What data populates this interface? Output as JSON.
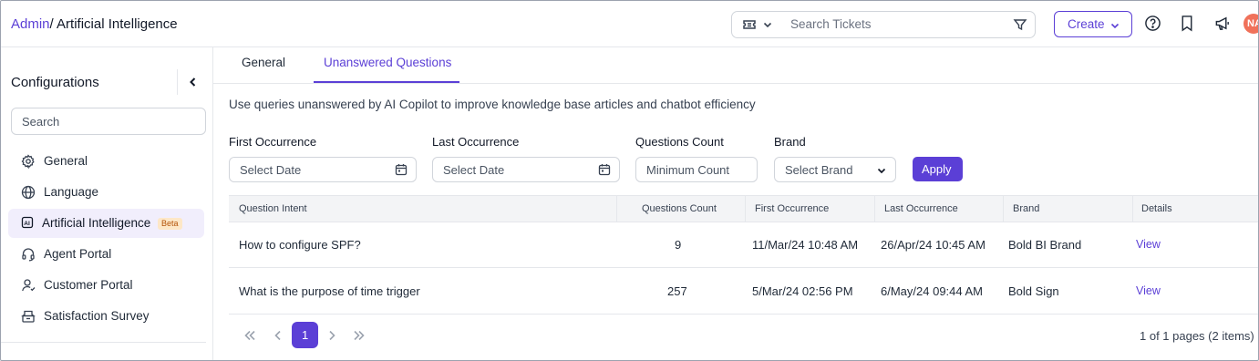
{
  "breadcrumb": {
    "parent": "Admin",
    "separator": "/",
    "current": "Artificial Intelligence"
  },
  "header": {
    "search_placeholder": "Search Tickets",
    "create_label": "Create",
    "avatar_initials": "NA",
    "icons": [
      "ticket-icon",
      "chevron-down-icon",
      "filter-icon",
      "help-icon",
      "bookmark-icon",
      "megaphone-icon"
    ]
  },
  "sidebar": {
    "title": "Configurations",
    "search_placeholder": "Search",
    "items": [
      {
        "label": "General",
        "icon": "gear-icon",
        "active": false
      },
      {
        "label": "Language",
        "icon": "globe-icon",
        "active": false
      },
      {
        "label": "Artificial Intelligence",
        "icon": "ai-icon",
        "active": true,
        "badge": "Beta"
      },
      {
        "label": "Agent Portal",
        "icon": "headset-icon",
        "active": false
      },
      {
        "label": "Customer Portal",
        "icon": "user-icon",
        "active": false
      },
      {
        "label": "Satisfaction Survey",
        "icon": "survey-icon",
        "active": false
      }
    ]
  },
  "tabs": [
    {
      "label": "General",
      "active": false
    },
    {
      "label": "Unanswered Questions",
      "active": true
    }
  ],
  "description": "Use queries unanswered by AI Copilot to improve knowledge base articles and chatbot efficiency",
  "filters": {
    "first_occurrence": {
      "label": "First Occurrence",
      "placeholder": "Select Date"
    },
    "last_occurrence": {
      "label": "Last Occurrence",
      "placeholder": "Select Date"
    },
    "questions_count": {
      "label": "Questions Count",
      "placeholder": "Minimum Count"
    },
    "brand": {
      "label": "Brand",
      "placeholder": "Select Brand"
    },
    "apply_label": "Apply"
  },
  "table": {
    "columns": [
      "Question Intent",
      "Questions Count",
      "First Occurrence",
      "Last Occurrence",
      "Brand",
      "Details"
    ],
    "rows": [
      {
        "intent": "How to configure SPF?",
        "count": "9",
        "first": "11/Mar/24 10:48 AM",
        "last": "26/Apr/24 10:45 AM",
        "brand": "Bold BI Brand",
        "details": "View"
      },
      {
        "intent": "What is the purpose of time trigger",
        "count": "257",
        "first": "5/Mar/24 02:56 PM",
        "last": "6/May/24 09:44 AM",
        "brand": "Bold Sign",
        "details": "View"
      }
    ]
  },
  "pagination": {
    "current_page": "1",
    "info": "1 of 1 pages (2 items)"
  },
  "colors": {
    "accent": "#5b3fd6",
    "active_bg": "#f1eefc",
    "avatar": "#f0715a",
    "beta_bg": "#fde7c7"
  }
}
